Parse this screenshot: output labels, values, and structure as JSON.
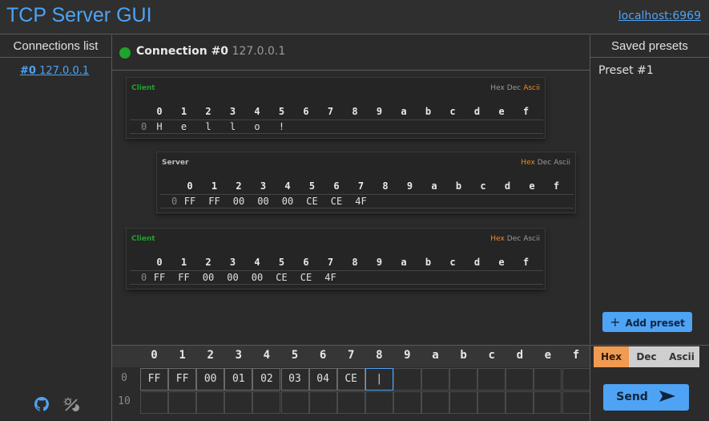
{
  "header": {
    "title": "TCP Server GUI",
    "host": "localhost:6969"
  },
  "connections": {
    "heading": "Connections list",
    "items": [
      {
        "id": "#0",
        "ip": "127.0.0.1"
      }
    ]
  },
  "connection": {
    "status_color": "#1fa32a",
    "label": "Connection #0",
    "ip": "127.0.0.1"
  },
  "columns": [
    "0",
    "1",
    "2",
    "3",
    "4",
    "5",
    "6",
    "7",
    "8",
    "9",
    "a",
    "b",
    "c",
    "d",
    "e",
    "f"
  ],
  "messages": [
    {
      "sender": "Client",
      "sender_color": "#1fa32a",
      "formats": [
        "Hex",
        "Dec",
        "Ascii"
      ],
      "active_format": "Ascii",
      "row_label": "0",
      "cells": [
        "H",
        "e",
        "l",
        "l",
        "o",
        "!"
      ]
    },
    {
      "sender": "Server",
      "sender_color": "#bdbdbd",
      "formats": [
        "Hex",
        "Dec",
        "Ascii"
      ],
      "active_format": "Hex",
      "row_label": "0",
      "cells": [
        "FF",
        "FF",
        "00",
        "00",
        "00",
        "CE",
        "CE",
        "4F"
      ]
    },
    {
      "sender": "Client",
      "sender_color": "#1fa32a",
      "formats": [
        "Hex",
        "Dec",
        "Ascii"
      ],
      "active_format": "Hex",
      "row_label": "0",
      "cells": [
        "FF",
        "FF",
        "00",
        "00",
        "00",
        "CE",
        "CE",
        "4F"
      ]
    }
  ],
  "presets": {
    "heading": "Saved presets",
    "items": [
      "Preset #1"
    ],
    "add_label": "Add preset"
  },
  "editor": {
    "row_labels": [
      "0",
      "10"
    ],
    "cells": [
      "FF",
      "FF",
      "00",
      "01",
      "02",
      "03",
      "04",
      "CE"
    ],
    "cursor": "|"
  },
  "send": {
    "formats": [
      "Hex",
      "Dec",
      "Ascii"
    ],
    "active_format": "Hex",
    "label": "Send"
  },
  "accent": "#4ea3f5",
  "highlight": "#f0892a"
}
